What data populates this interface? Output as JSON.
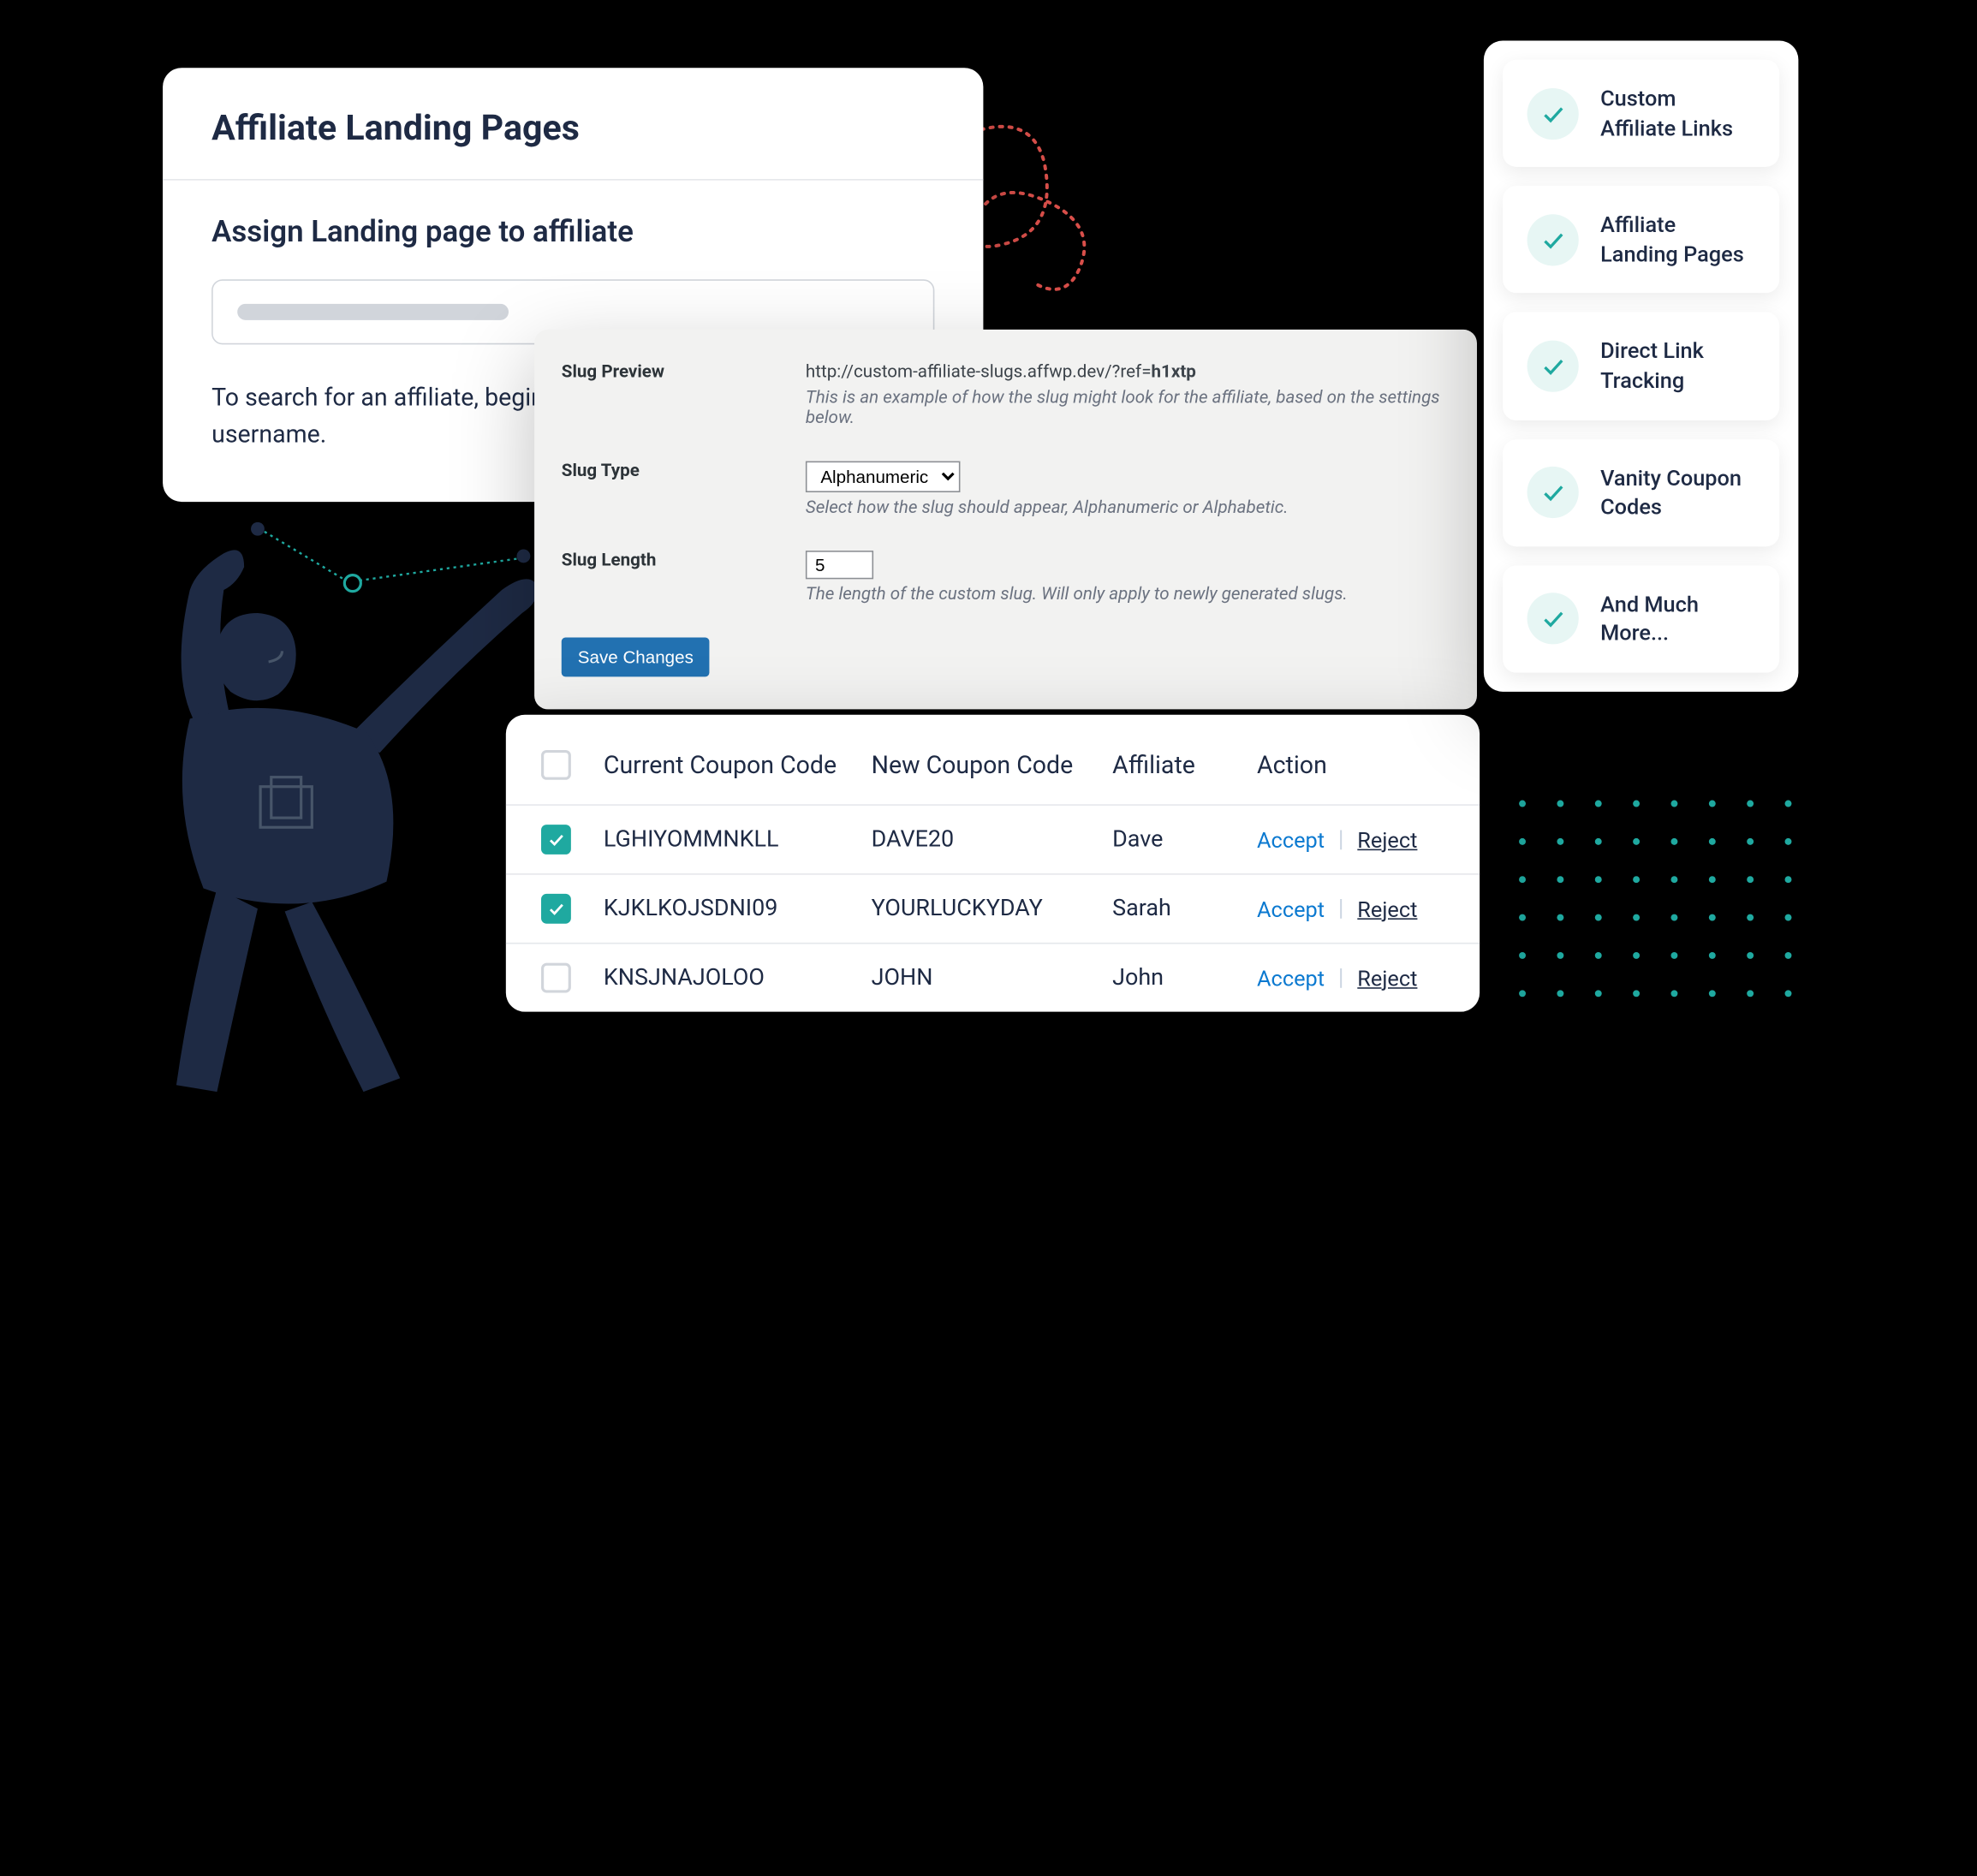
{
  "landing": {
    "title": "Affiliate Landing Pages",
    "subtitle": "Assign Landing page to affiliate",
    "help": "To search for an affiliate, begin typing their name, email address or username."
  },
  "slug": {
    "preview_label": "Slug Preview",
    "preview_url_prefix": "http://custom-affiliate-slugs.affwp.dev/?ref=",
    "preview_url_slug": "h1xtp",
    "preview_note": "This is an example of how the slug might look for the affiliate, based on the settings below.",
    "type_label": "Slug Type",
    "type_value": "Alphanumeric",
    "type_note": "Select how the slug should appear, Alphanumeric or Alphabetic.",
    "length_label": "Slug Length",
    "length_value": "5",
    "length_note": "The length of the custom slug. Will only apply to newly generated slugs.",
    "save": "Save Changes"
  },
  "coupon": {
    "headers": {
      "current": "Current Coupon Code",
      "new": "New Coupon Code",
      "affiliate": "Affiliate",
      "action": "Action"
    },
    "accept": "Accept",
    "reject": "Reject",
    "rows": [
      {
        "checked": true,
        "current": "LGHIYOMMNKLL",
        "new": "DAVE20",
        "affiliate": "Dave"
      },
      {
        "checked": true,
        "current": "KJKLKOJSDNI09",
        "new": "YOURLUCKYDAY",
        "affiliate": "Sarah"
      },
      {
        "checked": false,
        "current": "KNSJNAJOLOO",
        "new": "JOHN",
        "affiliate": "John"
      }
    ]
  },
  "features": [
    "Custom Affiliate Links",
    "Affiliate Landing Pages",
    "Direct Link Tracking",
    "Vanity Coupon Codes",
    "And Much More..."
  ]
}
